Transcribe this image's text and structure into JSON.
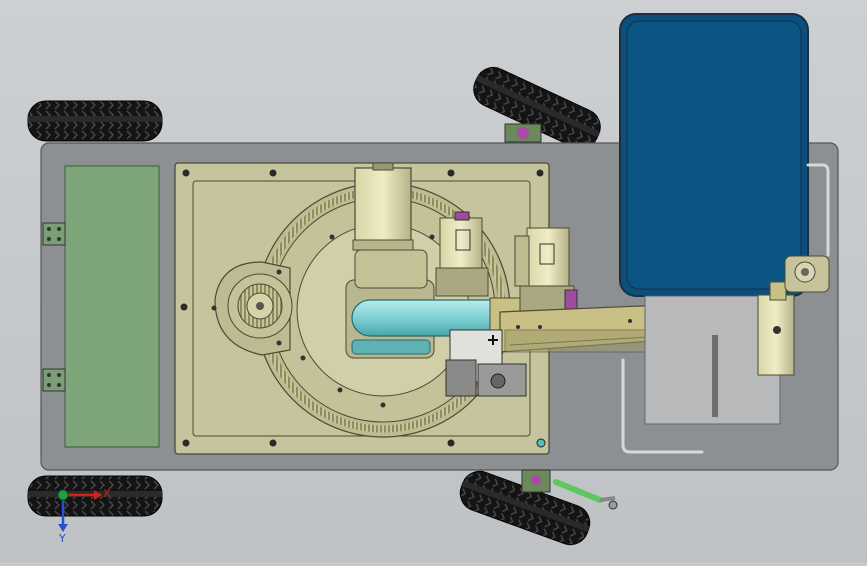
{
  "viewport": {
    "background_color": "#c5c8cc"
  },
  "model": {
    "chassis_color": "#8d9093",
    "base_plate_color": "#c6c49c",
    "battery_panel_color": "#7ea57a",
    "tank_color": "#0a4f7e",
    "arm_color": "#c8c084",
    "cylinder_color": "#7fd0d4",
    "tire_color": "#111111"
  },
  "triad": {
    "x_label": "X",
    "y_label": "Y",
    "x_color": "#d42020",
    "y_color": "#2a4fd0",
    "origin_color": "#20a040"
  }
}
